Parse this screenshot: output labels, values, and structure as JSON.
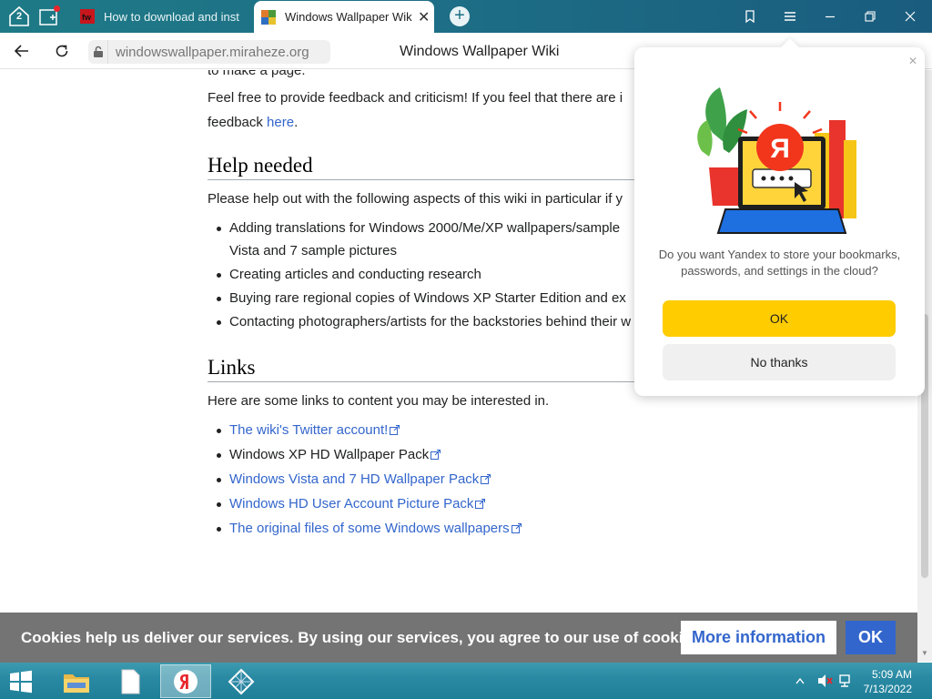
{
  "tabstrip": {
    "tab_count": "2",
    "tabs": [
      {
        "title": "How to download and inst"
      },
      {
        "title": "Windows Wallpaper Wiki",
        "close": "✕"
      }
    ],
    "add_tab": "+"
  },
  "addressbar": {
    "url": "windowswallpaper.miraheze.org",
    "page_title": "Windows Wallpaper Wiki"
  },
  "content": {
    "cut_line": "to make a page.",
    "feedback_text": "Feel free to provide feedback and criticism! If you feel that there are i",
    "feedback_text2": "feedback ",
    "feedback_link": "here",
    "feedback_end": ".",
    "help_heading": "Help needed",
    "help_intro": "Please help out with the following aspects of this wiki in particular if y",
    "help_items": [
      {
        "line1": "Adding translations for Windows 2000/Me/XP wallpapers/sample",
        "line2": "Vista and 7 sample pictures"
      },
      {
        "line1": "Creating articles and conducting research"
      },
      {
        "line1": "Buying rare regional copies of Windows XP Starter Edition and ex"
      },
      {
        "line1": "Contacting photographers/artists for the backstories behind their w"
      }
    ],
    "links_heading": "Links",
    "links_intro": "Here are some links to content you may be interested in.",
    "links": [
      {
        "text": "The wiki's Twitter account!",
        "color": "#3366cc"
      },
      {
        "text": "Windows XP HD Wallpaper Pack",
        "color": "#202122"
      },
      {
        "text": "Windows Vista and 7 HD Wallpaper Pack",
        "color": "#3366cc"
      },
      {
        "text": "Windows HD User Account Picture Pack",
        "color": "#3366cc"
      },
      {
        "text": "The original files of some Windows wallpapers",
        "color": "#3366cc"
      }
    ]
  },
  "cookie_banner": {
    "message": "Cookies help us deliver our services. By using our services, you agree to our use of cookies.",
    "more_label": "More information",
    "ok_label": "OK"
  },
  "popup": {
    "logo_letter": "Я",
    "question": "Do you want Yandex to store your bookmarks, passwords, and settings in the cloud?",
    "ok_label": "OK",
    "no_label": "No thanks",
    "accent": "#ffcc00"
  },
  "taskbar": {
    "time": "5:09 AM",
    "date": "7/13/2022"
  }
}
